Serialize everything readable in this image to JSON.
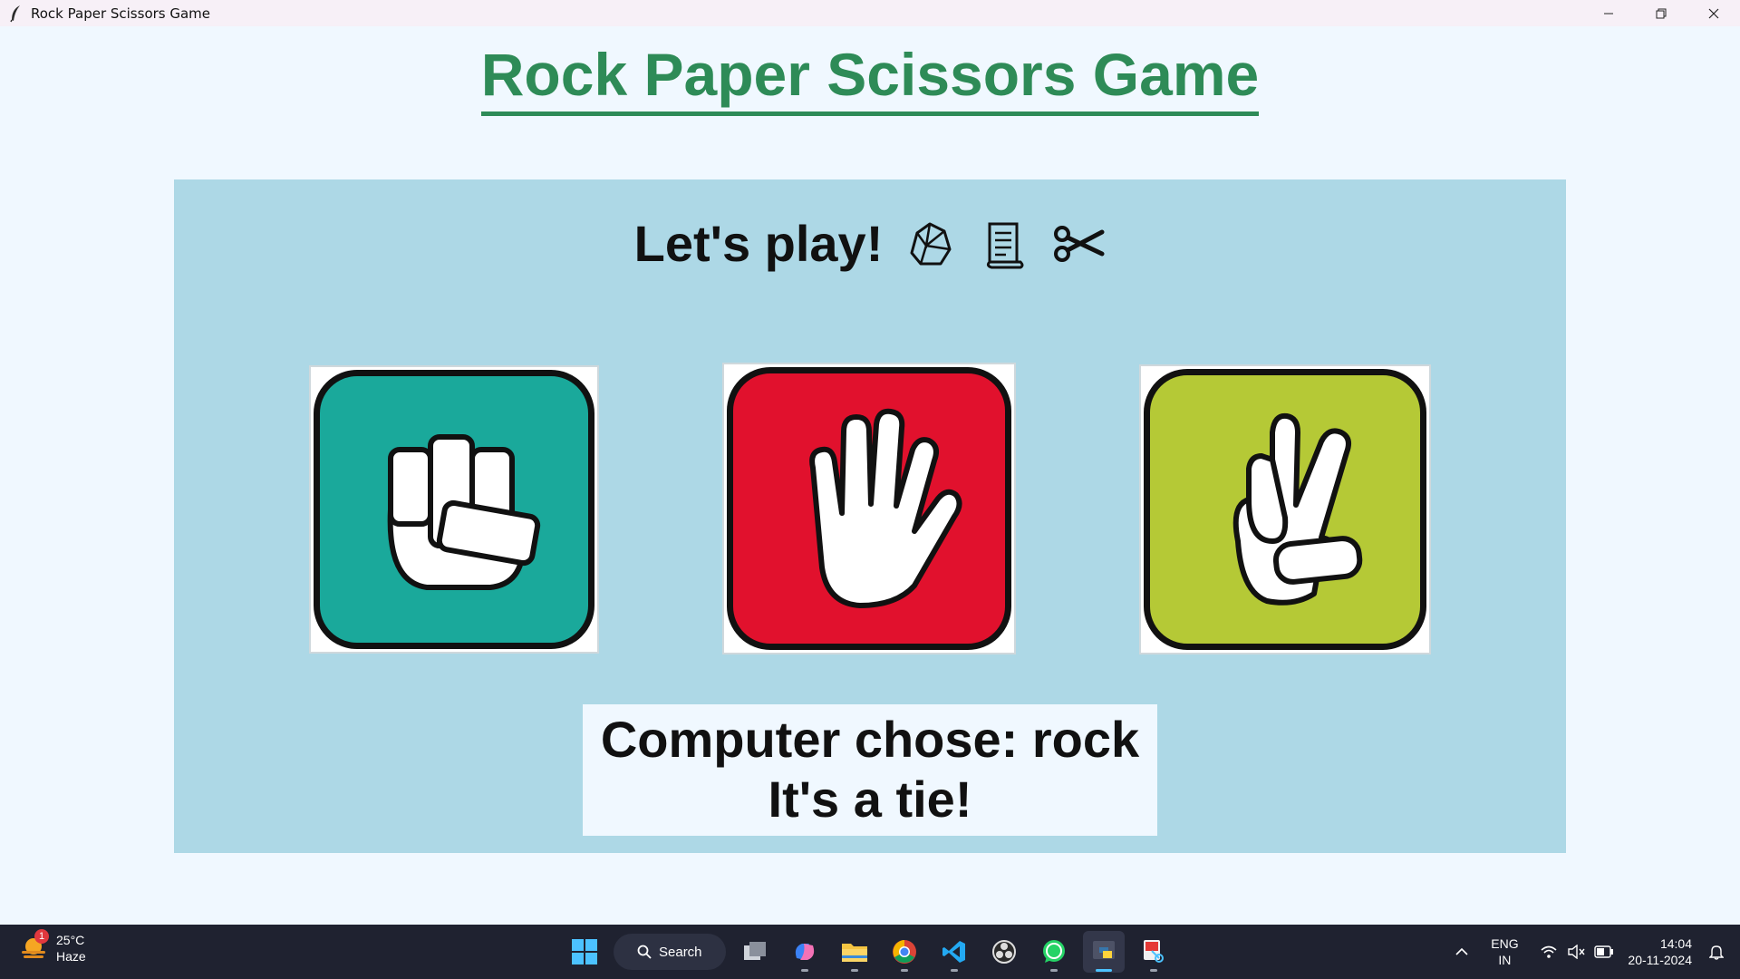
{
  "window": {
    "title": "Rock Paper Scissors Game"
  },
  "app": {
    "title": "Rock Paper Scissors Game",
    "heading": "Let's play!",
    "heading_icons": [
      "rock-icon",
      "scroll-icon",
      "scissors-icon"
    ],
    "choices": [
      {
        "name": "rock",
        "icon": "fist-icon",
        "color": "#1aa99b"
      },
      {
        "name": "paper",
        "icon": "open-hand-icon",
        "color": "#e1112d"
      },
      {
        "name": "scissors",
        "icon": "peace-sign-icon",
        "color": "#b5c936"
      }
    ],
    "result_line1": "Computer chose: rock",
    "result_line2": "It's a tie!",
    "colors": {
      "title": "#2e8b57",
      "panel": "#add8e6",
      "background": "#f0f8ff"
    }
  },
  "taskbar": {
    "weather_temp": "25°C",
    "weather_desc": "Haze",
    "weather_badge": "1",
    "search_label": "Search",
    "lang_line1": "ENG",
    "lang_line2": "IN",
    "time": "14:04",
    "date": "20-11-2024"
  }
}
